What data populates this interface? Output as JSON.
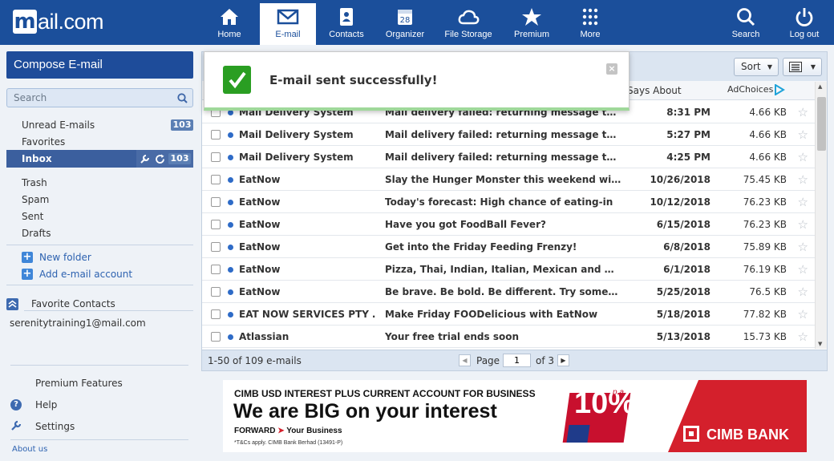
{
  "brand": {
    "logo_letter": "m",
    "logo_text": "ail.com"
  },
  "nav": {
    "items": [
      {
        "label": "Home",
        "icon": "home-icon"
      },
      {
        "label": "E-mail",
        "icon": "envelope-icon"
      },
      {
        "label": "Contacts",
        "icon": "contacts-icon"
      },
      {
        "label": "Organizer",
        "icon": "calendar-icon",
        "icon_text": "28"
      },
      {
        "label": "File Storage",
        "icon": "cloud-icon"
      },
      {
        "label": "Premium",
        "icon": "star-icon"
      },
      {
        "label": "More",
        "icon": "grid-icon"
      }
    ],
    "search_label": "Search",
    "logout_label": "Log out"
  },
  "sidebar": {
    "compose_label": "Compose E-mail",
    "search_placeholder": "Search",
    "unread_label": "Unread E-mails",
    "unread_count": "103",
    "favorites_label": "Favorites",
    "inbox_label": "Inbox",
    "inbox_count": "103",
    "folders": [
      "Trash",
      "Spam",
      "Sent",
      "Drafts"
    ],
    "new_folder": "New folder",
    "add_account": "Add e-mail account",
    "favorite_contacts": "Favorite Contacts",
    "contact_email": "serenitytraining1@mail.com",
    "premium_features": "Premium Features",
    "help": "Help",
    "settings": "Settings",
    "about": "About us"
  },
  "toolbar": {
    "sort_label": "Sort",
    "col_says_about": "Says About",
    "adchoices": "AdChoices"
  },
  "toast": {
    "message": "E-mail sent successfully!",
    "close": "×"
  },
  "emails": [
    {
      "sender": "Mail Delivery System",
      "subject": "Mail delivery failed: returning message to sen…",
      "date": "8:31 PM",
      "size": "4.66 KB"
    },
    {
      "sender": "Mail Delivery System",
      "subject": "Mail delivery failed: returning message to sen…",
      "date": "5:27 PM",
      "size": "4.66 KB"
    },
    {
      "sender": "Mail Delivery System",
      "subject": "Mail delivery failed: returning message to sen…",
      "date": "4:25 PM",
      "size": "4.66 KB"
    },
    {
      "sender": "EatNow",
      "subject": "Slay the Hunger Monster this weekend with u…",
      "date": "10/26/2018",
      "size": "75.45 KB"
    },
    {
      "sender": "EatNow",
      "subject": "Today's forecast: High chance of eating-in",
      "date": "10/12/2018",
      "size": "76.23 KB"
    },
    {
      "sender": "EatNow",
      "subject": "Have you got FoodBall Fever?",
      "date": "6/15/2018",
      "size": "76.23 KB"
    },
    {
      "sender": "EatNow",
      "subject": "Get into the Friday Feeding Frenzy!",
      "date": "6/8/2018",
      "size": "75.89 KB"
    },
    {
      "sender": "EatNow",
      "subject": "Pizza, Thai, Indian, Italian, Mexican and more…",
      "date": "6/1/2018",
      "size": "76.19 KB"
    },
    {
      "sender": "EatNow",
      "subject": "Be brave. Be bold. Be different. Try somethin…",
      "date": "5/25/2018",
      "size": "76.5 KB"
    },
    {
      "sender": "EAT NOW SERVICES PTY …",
      "subject": "Make Friday FOODelicious with EatNow",
      "date": "5/18/2018",
      "size": "77.82 KB"
    },
    {
      "sender": "Atlassian",
      "subject": "Your free trial ends soon",
      "date": "5/13/2018",
      "size": "15.73 KB"
    }
  ],
  "footer": {
    "summary": "1-50 of 109 e-mails",
    "page_label": "Page",
    "page_value": "1",
    "of_label": "of 3"
  },
  "ad": {
    "headline_small": "CIMB USD INTEREST PLUS CURRENT ACCOUNT FOR BUSINESS",
    "headline_big": "We are BIG on your interest",
    "forward": "FORWARD",
    "your_business": "Your Business",
    "terms": "*T&Cs apply.  CIMB Bank Berhad (13491-P)",
    "pct_number": "10",
    "pct_sign": "%",
    "pct_pa": "p.a.",
    "bank": "CIMB BANK"
  },
  "colors": {
    "brand_blue": "#1b4f9b",
    "success_green": "#2a9e22",
    "ad_red": "#d4202c"
  }
}
